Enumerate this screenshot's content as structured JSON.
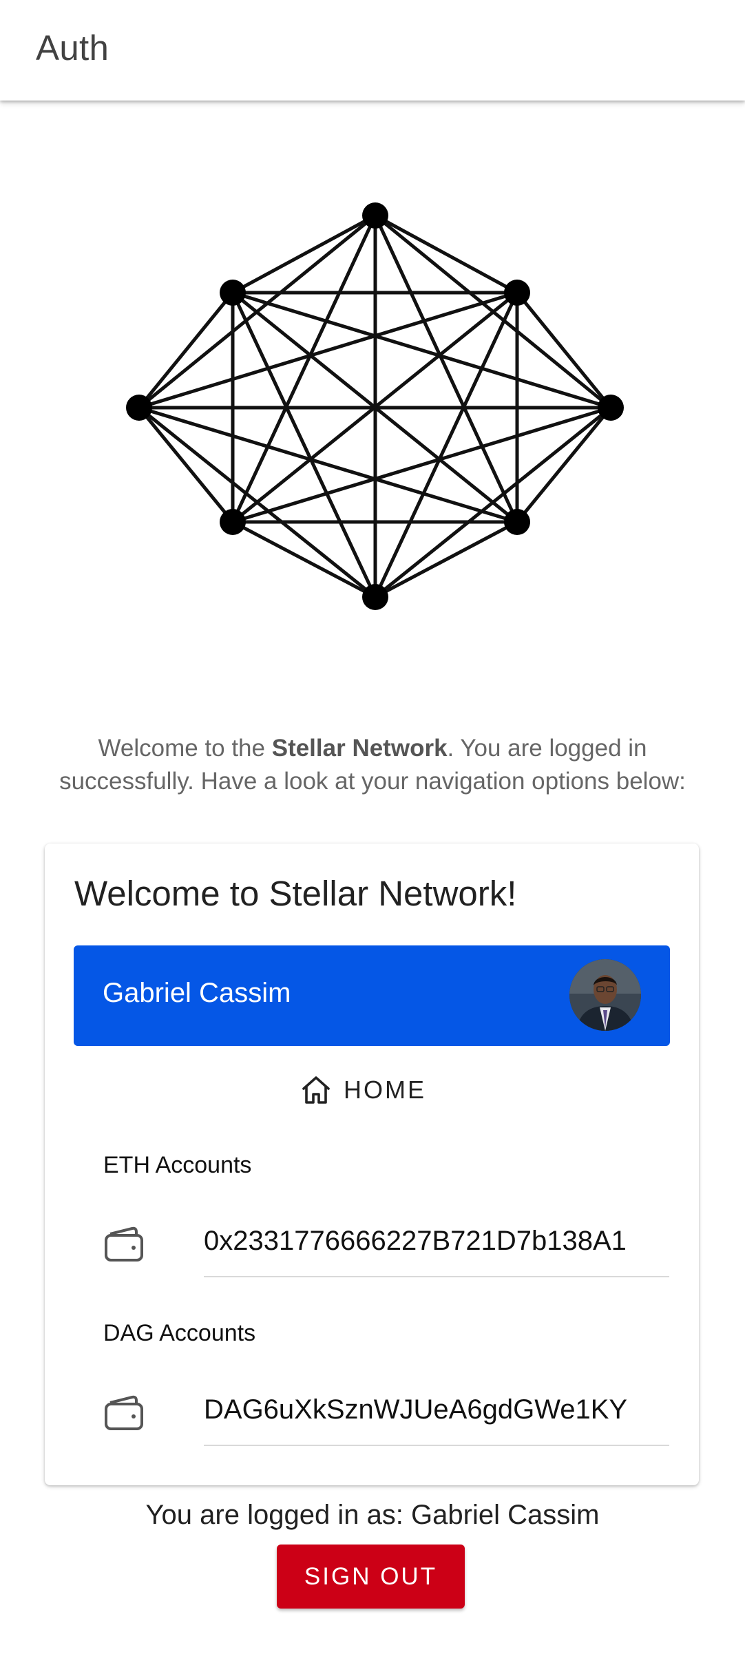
{
  "appbar": {
    "title": "Auth"
  },
  "intro": {
    "prefix": "Welcome to the ",
    "brand": "Stellar Network",
    "suffix": ". You are logged in successfully. Have a look at your navigation options below:"
  },
  "card": {
    "title": "Welcome to Stellar Network!",
    "user_name": "Gabriel Cassim",
    "home_label": "HOME",
    "eth_label": "ETH Accounts",
    "eth_account": "0x2331776666227B721D7b138A1",
    "dag_label": "DAG Accounts",
    "dag_account": "DAG6uXkSznWJUeA6gdGWe1KY"
  },
  "footer": {
    "logged_in_text": "You are logged in as: Gabriel Cassim",
    "signout_label": "SIGN OUT"
  },
  "colors": {
    "primary": "#0557e6",
    "danger": "#cc0016"
  }
}
